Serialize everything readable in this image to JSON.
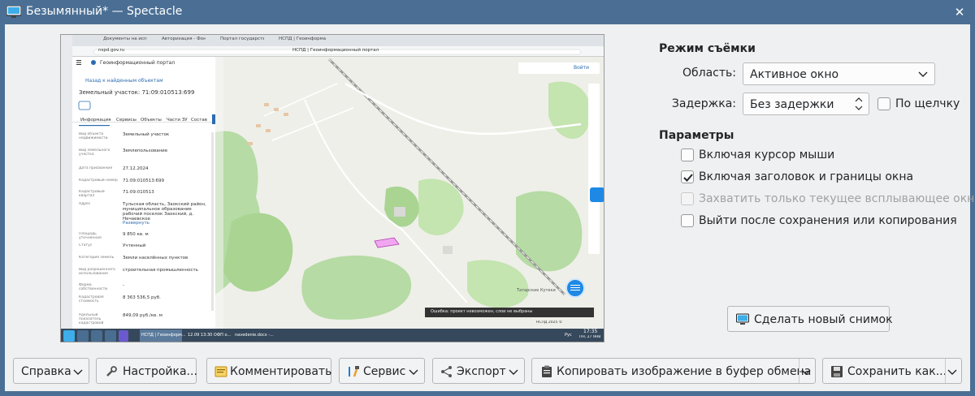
{
  "window": {
    "title": "Безымянный* — Spectacle"
  },
  "capture_mode": {
    "section_title": "Режим съёмки",
    "area_label": "Область:",
    "area_value": "Активное окно",
    "delay_label": "Задержка:",
    "delay_value": "Без задержки",
    "on_click_label": "По щелчку",
    "on_click_checked": false
  },
  "options": {
    "section_title": "Параметры",
    "items": [
      {
        "label": "Включая курсор мыши",
        "checked": false,
        "enabled": true
      },
      {
        "label": "Включая заголовок и границы окна",
        "checked": true,
        "enabled": true
      },
      {
        "label": "Захватить только текущее всплывающее окно",
        "checked": false,
        "enabled": false
      },
      {
        "label": "Выйти после сохранения или копирования",
        "checked": false,
        "enabled": true
      }
    ]
  },
  "new_screenshot_button": "Сделать новый снимок",
  "footer": {
    "help": "Справка",
    "configure": "Настройка...",
    "annotate": "Комментировать",
    "tools": "Сервис",
    "export": "Экспорт",
    "copy": "Копировать изображение в буфер обмена",
    "save_as": "Сохранить как..."
  },
  "preview": {
    "tabs": [
      "Документы на испол...",
      "Авторизация - Фонд ин...",
      "Портал государственн...",
      "НСПД | Геоинформацио..."
    ],
    "address": "nspd.gov.ru",
    "page_title": "НСПД | Геоинформационный портал",
    "portal_name": "Геоинформационный портал",
    "back_link": "Назад к найденным объектам",
    "parcel_title": "Земельный участок: 71:09:010513:699",
    "panel_tabs": [
      "Информация",
      "Сервисы",
      "Объекты",
      "Части ЗУ",
      "Состав"
    ],
    "info_rows": [
      {
        "k": "Вид объекта недвижимости",
        "v": "Земельный участок"
      },
      {
        "k": "Вид земельного участка",
        "v": "Землепользование"
      },
      {
        "k": "Дата присвоения",
        "v": "27.12.2024"
      },
      {
        "k": "Кадастровый номер",
        "v": "71:09:010513:699"
      },
      {
        "k": "Кадастровый квартал",
        "v": "71:09:010513"
      },
      {
        "k": "Адрес",
        "v": "Тульская область, Заокский район, муниципальное образование рабочий поселок Заокский, д. Нечаевское"
      },
      {
        "k": "",
        "v": "Развернуть"
      },
      {
        "k": "Площадь уточненная",
        "v": "9 850 кв. м"
      },
      {
        "k": "Статус",
        "v": "Учтенный"
      },
      {
        "k": "Категория земель",
        "v": "Земли населённых пунктов"
      },
      {
        "k": "Вид разрешенного использования",
        "v": "строительная промышленность"
      },
      {
        "k": "Форма собственности",
        "v": "-"
      },
      {
        "k": "Кадастровая стоимость",
        "v": "8 363 536,5 руб."
      },
      {
        "k": "Удельный показатель кадастровой",
        "v": "849,09 руб./кв. м"
      }
    ],
    "login": "Войти",
    "error": "Ошибка: проект невозможен, слои не выбраны",
    "place_label": "Татарские Кутеки",
    "taskbar_items": [
      "НСПД | Геоинформ...",
      "12.09 13:30 ОФП о...",
      "navedenie.docx -..."
    ],
    "clock_time": "17:35",
    "clock_date": "ПН, 27 ЯНВ",
    "layout": "Рус",
    "map_copyright": "НСПД 2025 ©"
  }
}
